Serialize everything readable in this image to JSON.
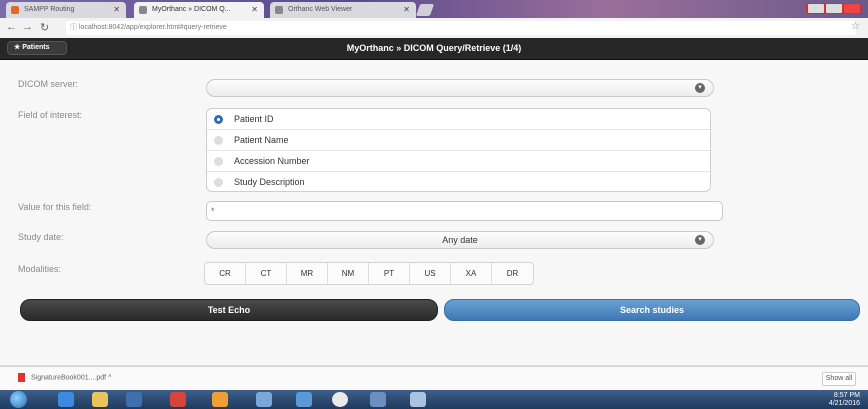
{
  "browser": {
    "tabs": [
      {
        "title": "SAMPP Routing",
        "favicon_color": "#e06a2c",
        "active": false
      },
      {
        "title": "MyOrthanc » DICOM Q...",
        "favicon_color": "#888888",
        "active": true
      },
      {
        "title": "Orthanc Web Viewer",
        "favicon_color": "#888888",
        "active": false
      }
    ],
    "url": "localhost:8042/app/explorer.html#query-retrieve"
  },
  "header": {
    "patients_label": "Patients",
    "title": "MyOrthanc » DICOM Query/Retrieve (1/4)"
  },
  "form": {
    "dicom_server": {
      "label": "DICOM server:",
      "value": ""
    },
    "field_of_interest": {
      "label": "Field of interest:",
      "options": [
        {
          "label": "Patient ID",
          "selected": true
        },
        {
          "label": "Patient Name",
          "selected": false
        },
        {
          "label": "Accession Number",
          "selected": false
        },
        {
          "label": "Study Description",
          "selected": false
        }
      ]
    },
    "value_field": {
      "label": "Value for this field:",
      "value": "*"
    },
    "study_date": {
      "label": "Study date:",
      "value": "Any date"
    },
    "modalities": {
      "label": "Modalities:",
      "items": [
        "CR",
        "CT",
        "MR",
        "NM",
        "PT",
        "US",
        "XA",
        "DR"
      ]
    }
  },
  "actions": {
    "test_echo": "Test Echo",
    "search_studies": "Search studies"
  },
  "downloads": {
    "file": "SignatureBook001....pdf",
    "show_all": "Show all"
  },
  "taskbar": {
    "time": "8:57 PM",
    "date": "4/21/2016"
  },
  "colors": {
    "header_bg": "#272727",
    "search_button": "#4a86c4",
    "echo_button": "#333333",
    "radio_selected": "#2e6db5"
  }
}
